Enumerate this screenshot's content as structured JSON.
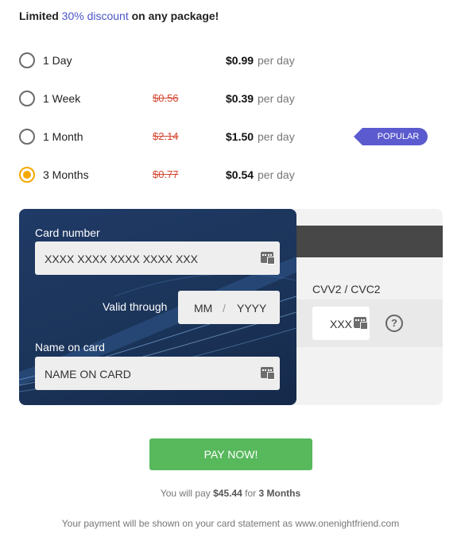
{
  "headline": {
    "prefix": "Limited ",
    "accent": "30% discount",
    "suffix": " on any package!"
  },
  "plans": [
    {
      "label": "1 Day",
      "old_price": "",
      "price": "$0.99",
      "unit": "per day",
      "selected": false
    },
    {
      "label": "1 Week",
      "old_price": "$0.56",
      "price": "$0.39",
      "unit": "per day",
      "selected": false
    },
    {
      "label": "1 Month",
      "old_price": "$2.14",
      "price": "$1.50",
      "unit": "per day",
      "selected": false
    },
    {
      "label": "3 Months",
      "old_price": "$0.77",
      "price": "$0.54",
      "unit": "per day",
      "selected": true
    }
  ],
  "popular_badge": "POPULAR",
  "card": {
    "number_label": "Card number",
    "number_placeholder": "XXXX XXXX XXXX XXXX XXX",
    "valid_label": "Valid through",
    "month_placeholder": "MM",
    "date_separator": "/",
    "year_placeholder": "YYYY",
    "name_label": "Name on card",
    "name_placeholder": "NAME ON CARD",
    "cvv_label": "CVV2 / CVC2",
    "cvv_placeholder": "XXX",
    "help_symbol": "?"
  },
  "pay_button": "PAY NOW!",
  "summary": {
    "prefix": "You will pay ",
    "amount": "$45.44",
    "middle": " for ",
    "package": "3 Months"
  },
  "statement": "Your payment will be shown on your card statement as www.onenightfriend.com",
  "colors": {
    "accent": "#4a55c9",
    "selected": "#f5a800",
    "strike": "#d4472f",
    "pay": "#57b85c",
    "card": "#1f3a66",
    "badge": "#5b5bcf"
  }
}
